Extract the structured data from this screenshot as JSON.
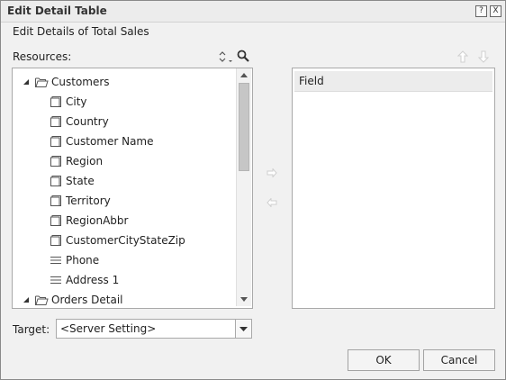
{
  "dialog": {
    "title": "Edit Detail Table",
    "help_label": "?",
    "close_label": "X",
    "subtitle": "Edit Details of Total Sales",
    "resources_label": "Resources:"
  },
  "tree": {
    "items": [
      {
        "label": "Customers",
        "kind": "folder",
        "expanded": true
      },
      {
        "label": "City",
        "kind": "dimension"
      },
      {
        "label": "Country",
        "kind": "dimension"
      },
      {
        "label": "Customer Name",
        "kind": "dimension"
      },
      {
        "label": "Region",
        "kind": "dimension"
      },
      {
        "label": "State",
        "kind": "dimension"
      },
      {
        "label": "Territory",
        "kind": "dimension"
      },
      {
        "label": "RegionAbbr",
        "kind": "dimension"
      },
      {
        "label": "CustomerCityStateZip",
        "kind": "dimension"
      },
      {
        "label": "Phone",
        "kind": "detail"
      },
      {
        "label": "Address 1",
        "kind": "detail"
      },
      {
        "label": "Orders Detail",
        "kind": "folder",
        "expanded": true
      }
    ]
  },
  "fields": {
    "header": "Field",
    "items": []
  },
  "target": {
    "label": "Target:",
    "selected": "<Server Setting>"
  },
  "buttons": {
    "ok": "OK",
    "cancel": "Cancel"
  }
}
